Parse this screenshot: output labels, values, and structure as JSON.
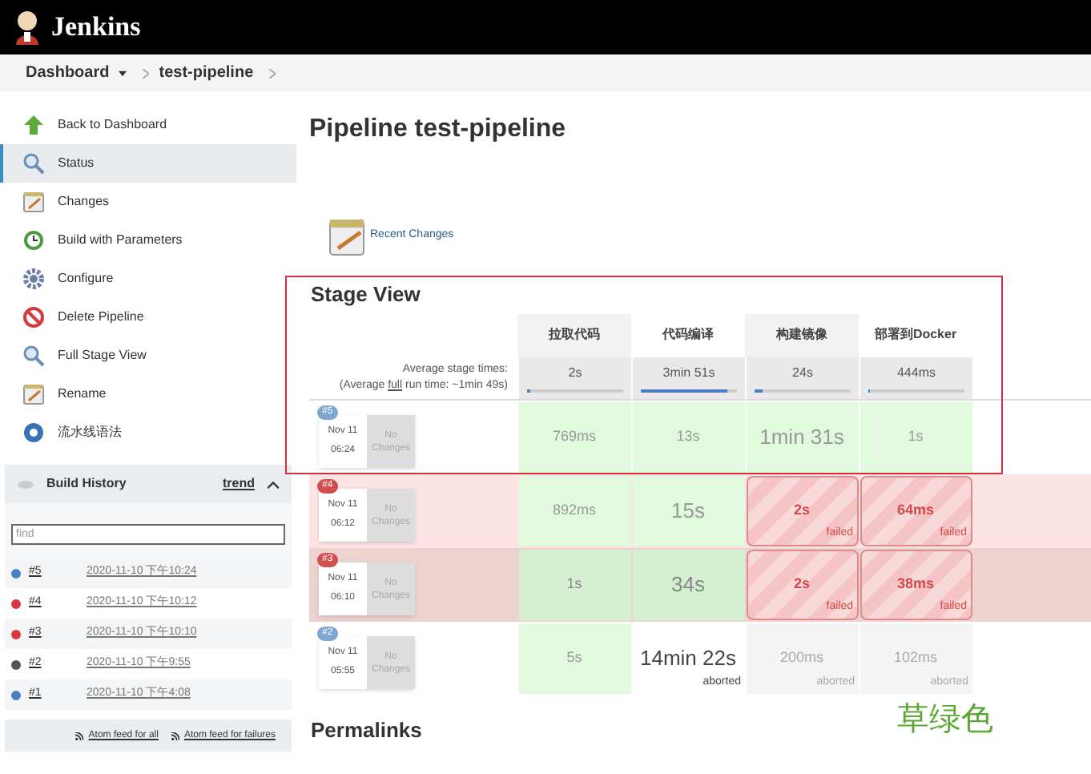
{
  "header": {
    "title": "Jenkins"
  },
  "breadcrumb": [
    {
      "label": "Dashboard",
      "has_menu": true
    },
    {
      "label": "test-pipeline",
      "has_menu": false
    }
  ],
  "sidebar": {
    "items": [
      {
        "label": "Back to Dashboard",
        "kind": "up",
        "selected": false
      },
      {
        "label": "Status",
        "kind": "search",
        "selected": true
      },
      {
        "label": "Changes",
        "kind": "notepad",
        "selected": false
      },
      {
        "label": "Build with Parameters",
        "kind": "clock",
        "selected": false
      },
      {
        "label": "Configure",
        "kind": "gear",
        "selected": false
      },
      {
        "label": "Delete Pipeline",
        "kind": "no",
        "selected": false
      },
      {
        "label": "Full Stage View",
        "kind": "search",
        "selected": false
      },
      {
        "label": "Rename",
        "kind": "notepad",
        "selected": false
      },
      {
        "label": "流水线语法",
        "kind": "help",
        "selected": false
      }
    ]
  },
  "build_history": {
    "title": "Build History",
    "trend": "trend",
    "expanded": true,
    "search": {
      "value": "find"
    },
    "builds": [
      {
        "number": "#5",
        "time": "2020-11-10 下午10:24",
        "color": "#4a7fc1"
      },
      {
        "number": "#4",
        "time": "2020-11-10 下午10:12",
        "color": "#d9393e"
      },
      {
        "number": "#3",
        "time": "2020-11-10 下午10:10",
        "color": "#d9393e"
      },
      {
        "number": "#2",
        "time": "2020-11-10 下午9:55",
        "color": "#555555"
      },
      {
        "number": "#1",
        "time": "2020-11-10 下午4:08",
        "color": "#4a7fc1"
      }
    ],
    "feeds": [
      "Atom feed for all",
      "Atom feed for failures"
    ]
  },
  "page_title": "Pipeline test-pipeline",
  "recent_changes": "Recent Changes",
  "stage_view": {
    "title": "Stage View",
    "stages": [
      {
        "name": "拉取代码",
        "selected": false
      },
      {
        "name": "代码编译",
        "selected": true
      },
      {
        "name": "构建镜像",
        "selected": false
      },
      {
        "name": "部署到Docker",
        "selected": true
      }
    ],
    "average_label": "Average stage times:",
    "average_run": {
      "before": "(Average ",
      "link": "full",
      "after": " run time: ~1min 49s)"
    },
    "averages": [
      {
        "time": "2s",
        "level": 0.03
      },
      {
        "time": "3min 51s",
        "level": 0.9
      },
      {
        "time": "24s",
        "level": 0.08
      },
      {
        "time": "444ms",
        "level": 0.02
      }
    ],
    "runs": [
      {
        "badge": "#5",
        "kind": "success",
        "hovered": false,
        "date": "Nov 11",
        "time": "06:24",
        "changes": "No Changes",
        "cells": [
          {
            "time": "769ms",
            "kind": "success",
            "large": false
          },
          {
            "time": "13s",
            "kind": "success",
            "large": false
          },
          {
            "time": "1min 31s",
            "kind": "success",
            "large": true
          },
          {
            "time": "1s",
            "kind": "success",
            "large": false
          }
        ]
      },
      {
        "badge": "#4",
        "kind": "failed",
        "hovered": false,
        "date": "Nov 11",
        "time": "06:12",
        "changes": "No Changes",
        "cells": [
          {
            "time": "892ms",
            "kind": "success",
            "large": false
          },
          {
            "time": "15s",
            "kind": "success",
            "large": true
          },
          {
            "time": "2s",
            "kind": "failed",
            "large": false,
            "note": "failed"
          },
          {
            "time": "64ms",
            "kind": "failed",
            "large": false,
            "note": "failed"
          }
        ]
      },
      {
        "badge": "#3",
        "kind": "failed",
        "hovered": true,
        "date": "Nov 11",
        "time": "06:10",
        "changes": "No Changes",
        "cells": [
          {
            "time": "1s",
            "kind": "success",
            "large": false
          },
          {
            "time": "34s",
            "kind": "success",
            "large": true
          },
          {
            "time": "2s",
            "kind": "failed",
            "large": false,
            "note": "failed"
          },
          {
            "time": "38ms",
            "kind": "failed",
            "large": false,
            "note": "failed"
          }
        ]
      },
      {
        "badge": "#2",
        "kind": "aborted",
        "hovered": false,
        "date": "Nov 11",
        "time": "05:55",
        "changes": "No Changes",
        "cells": [
          {
            "time": "5s",
            "kind": "success",
            "large": false
          },
          {
            "time": "14min 22s",
            "kind": "aborted",
            "large": true,
            "note": "aborted"
          },
          {
            "time": "200ms",
            "kind": "aborted",
            "large": false,
            "note": "aborted"
          },
          {
            "time": "102ms",
            "kind": "aborted",
            "large": false,
            "note": "aborted"
          }
        ]
      }
    ]
  },
  "permalinks": "Permalinks",
  "annotation": {
    "label": "草绿色"
  }
}
